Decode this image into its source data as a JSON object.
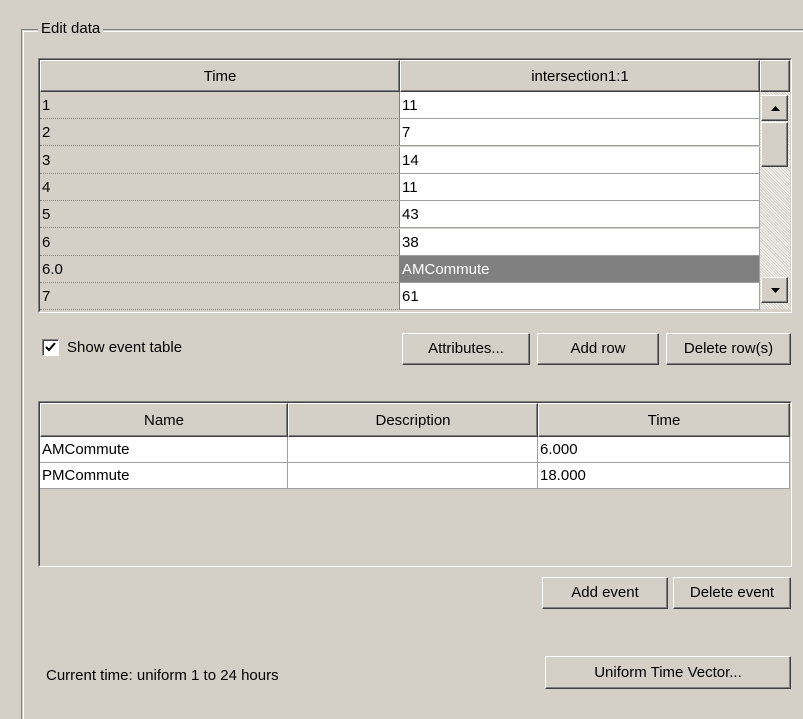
{
  "group": {
    "title": "Edit data"
  },
  "data_table": {
    "columns": [
      "Time",
      "intersection1:1"
    ],
    "rows": [
      [
        "1",
        "11"
      ],
      [
        "2",
        "7"
      ],
      [
        "3",
        "14"
      ],
      [
        "4",
        "11"
      ],
      [
        "5",
        "43"
      ],
      [
        "6",
        "38"
      ],
      [
        "6.0",
        "AMCommute"
      ],
      [
        "7",
        "61"
      ]
    ],
    "selected_row": 6
  },
  "show_event_table": {
    "label": "Show event table",
    "checked": true
  },
  "buttons": {
    "attributes": "Attributes...",
    "add_row": "Add row",
    "delete_rows": "Delete row(s)",
    "add_event": "Add event",
    "delete_event": "Delete event",
    "uniform_time_vector": "Uniform Time Vector..."
  },
  "event_table": {
    "columns": [
      "Name",
      "Description",
      "Time"
    ],
    "rows": [
      [
        "AMCommute",
        "",
        "6.000"
      ],
      [
        "PMCommute",
        "",
        "18.000"
      ]
    ]
  },
  "status": {
    "current_time": "Current time: uniform 1 to 24 hours"
  },
  "icons": {
    "scroll_up": "scroll-up-arrow-icon",
    "scroll_down": "scroll-down-arrow-icon",
    "check": "checkmark-icon"
  }
}
